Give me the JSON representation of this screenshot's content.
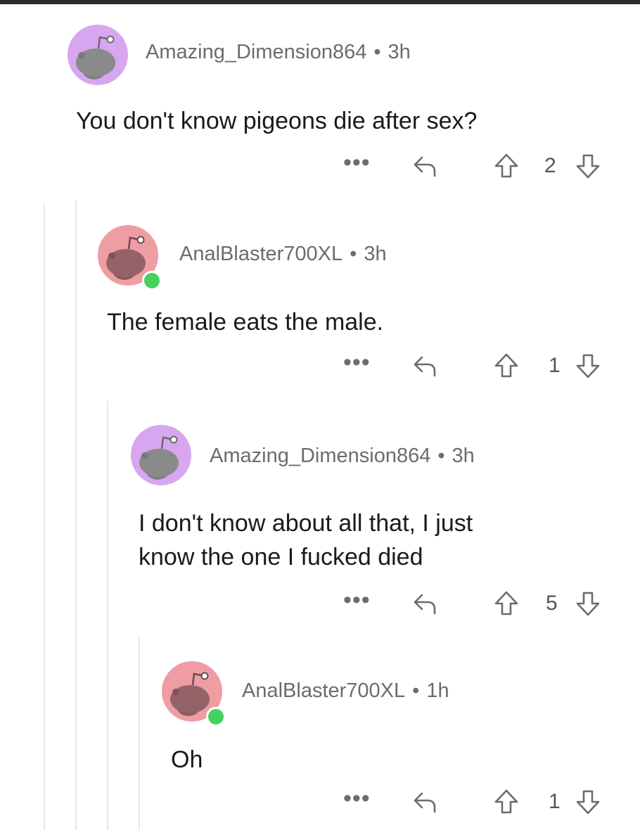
{
  "comments": [
    {
      "username": "Amazing_Dimension864",
      "separator": "•",
      "time": "3h",
      "body": "You don't know pigeons die after sex?",
      "more": "•••",
      "votes": "2",
      "avatar_bg": "#d7a6f0",
      "online": false
    },
    {
      "username": "AnalBlaster700XL",
      "separator": "•",
      "time": "3h",
      "body": "The female eats the male.",
      "more": "•••",
      "votes": "1",
      "avatar_bg": "#ee9da3",
      "online": true
    },
    {
      "username": "Amazing_Dimension864",
      "separator": "•",
      "time": "3h",
      "body_line1": "I don't know about all that, I just",
      "body_line2": "know the one I fucked died",
      "more": "•••",
      "votes": "5",
      "avatar_bg": "#d7a6f0",
      "online": false
    },
    {
      "username": "AnalBlaster700XL",
      "separator": "•",
      "time": "1h",
      "body": "Oh",
      "more": "•••",
      "votes": "1",
      "avatar_bg": "#ee9da3",
      "online": true
    }
  ],
  "colors": {
    "online_dot": "#46d160",
    "meta_text": "#6c6c6c",
    "thread_line": "#e6e6e6"
  }
}
